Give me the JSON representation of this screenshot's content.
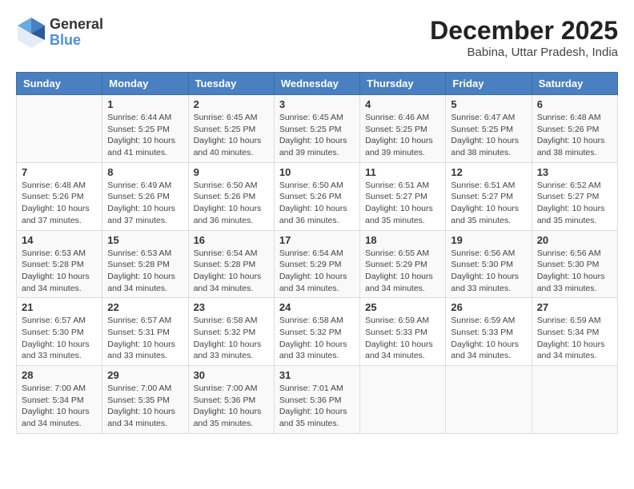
{
  "header": {
    "logo_line1": "General",
    "logo_line2": "Blue",
    "title": "December 2025",
    "subtitle": "Babina, Uttar Pradesh, India"
  },
  "days_of_week": [
    "Sunday",
    "Monday",
    "Tuesday",
    "Wednesday",
    "Thursday",
    "Friday",
    "Saturday"
  ],
  "weeks": [
    [
      {
        "day": "",
        "info": ""
      },
      {
        "day": "1",
        "info": "Sunrise: 6:44 AM\nSunset: 5:25 PM\nDaylight: 10 hours\nand 41 minutes."
      },
      {
        "day": "2",
        "info": "Sunrise: 6:45 AM\nSunset: 5:25 PM\nDaylight: 10 hours\nand 40 minutes."
      },
      {
        "day": "3",
        "info": "Sunrise: 6:45 AM\nSunset: 5:25 PM\nDaylight: 10 hours\nand 39 minutes."
      },
      {
        "day": "4",
        "info": "Sunrise: 6:46 AM\nSunset: 5:25 PM\nDaylight: 10 hours\nand 39 minutes."
      },
      {
        "day": "5",
        "info": "Sunrise: 6:47 AM\nSunset: 5:25 PM\nDaylight: 10 hours\nand 38 minutes."
      },
      {
        "day": "6",
        "info": "Sunrise: 6:48 AM\nSunset: 5:26 PM\nDaylight: 10 hours\nand 38 minutes."
      }
    ],
    [
      {
        "day": "7",
        "info": "Sunrise: 6:48 AM\nSunset: 5:26 PM\nDaylight: 10 hours\nand 37 minutes."
      },
      {
        "day": "8",
        "info": "Sunrise: 6:49 AM\nSunset: 5:26 PM\nDaylight: 10 hours\nand 37 minutes."
      },
      {
        "day": "9",
        "info": "Sunrise: 6:50 AM\nSunset: 5:26 PM\nDaylight: 10 hours\nand 36 minutes."
      },
      {
        "day": "10",
        "info": "Sunrise: 6:50 AM\nSunset: 5:26 PM\nDaylight: 10 hours\nand 36 minutes."
      },
      {
        "day": "11",
        "info": "Sunrise: 6:51 AM\nSunset: 5:27 PM\nDaylight: 10 hours\nand 35 minutes."
      },
      {
        "day": "12",
        "info": "Sunrise: 6:51 AM\nSunset: 5:27 PM\nDaylight: 10 hours\nand 35 minutes."
      },
      {
        "day": "13",
        "info": "Sunrise: 6:52 AM\nSunset: 5:27 PM\nDaylight: 10 hours\nand 35 minutes."
      }
    ],
    [
      {
        "day": "14",
        "info": "Sunrise: 6:53 AM\nSunset: 5:28 PM\nDaylight: 10 hours\nand 34 minutes."
      },
      {
        "day": "15",
        "info": "Sunrise: 6:53 AM\nSunset: 5:28 PM\nDaylight: 10 hours\nand 34 minutes."
      },
      {
        "day": "16",
        "info": "Sunrise: 6:54 AM\nSunset: 5:28 PM\nDaylight: 10 hours\nand 34 minutes."
      },
      {
        "day": "17",
        "info": "Sunrise: 6:54 AM\nSunset: 5:29 PM\nDaylight: 10 hours\nand 34 minutes."
      },
      {
        "day": "18",
        "info": "Sunrise: 6:55 AM\nSunset: 5:29 PM\nDaylight: 10 hours\nand 34 minutes."
      },
      {
        "day": "19",
        "info": "Sunrise: 6:56 AM\nSunset: 5:30 PM\nDaylight: 10 hours\nand 33 minutes."
      },
      {
        "day": "20",
        "info": "Sunrise: 6:56 AM\nSunset: 5:30 PM\nDaylight: 10 hours\nand 33 minutes."
      }
    ],
    [
      {
        "day": "21",
        "info": "Sunrise: 6:57 AM\nSunset: 5:30 PM\nDaylight: 10 hours\nand 33 minutes."
      },
      {
        "day": "22",
        "info": "Sunrise: 6:57 AM\nSunset: 5:31 PM\nDaylight: 10 hours\nand 33 minutes."
      },
      {
        "day": "23",
        "info": "Sunrise: 6:58 AM\nSunset: 5:32 PM\nDaylight: 10 hours\nand 33 minutes."
      },
      {
        "day": "24",
        "info": "Sunrise: 6:58 AM\nSunset: 5:32 PM\nDaylight: 10 hours\nand 33 minutes."
      },
      {
        "day": "25",
        "info": "Sunrise: 6:59 AM\nSunset: 5:33 PM\nDaylight: 10 hours\nand 34 minutes."
      },
      {
        "day": "26",
        "info": "Sunrise: 6:59 AM\nSunset: 5:33 PM\nDaylight: 10 hours\nand 34 minutes."
      },
      {
        "day": "27",
        "info": "Sunrise: 6:59 AM\nSunset: 5:34 PM\nDaylight: 10 hours\nand 34 minutes."
      }
    ],
    [
      {
        "day": "28",
        "info": "Sunrise: 7:00 AM\nSunset: 5:34 PM\nDaylight: 10 hours\nand 34 minutes."
      },
      {
        "day": "29",
        "info": "Sunrise: 7:00 AM\nSunset: 5:35 PM\nDaylight: 10 hours\nand 34 minutes."
      },
      {
        "day": "30",
        "info": "Sunrise: 7:00 AM\nSunset: 5:36 PM\nDaylight: 10 hours\nand 35 minutes."
      },
      {
        "day": "31",
        "info": "Sunrise: 7:01 AM\nSunset: 5:36 PM\nDaylight: 10 hours\nand 35 minutes."
      },
      {
        "day": "",
        "info": ""
      },
      {
        "day": "",
        "info": ""
      },
      {
        "day": "",
        "info": ""
      }
    ]
  ]
}
